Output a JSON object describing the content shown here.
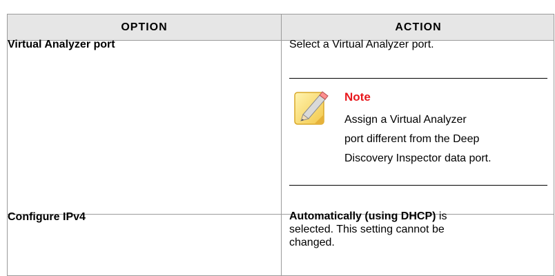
{
  "table": {
    "headers": {
      "option": "Option",
      "action": "Action"
    },
    "rows": [
      {
        "option": "Virtual Analyzer port",
        "action": "Select a Virtual Analyzer port.",
        "note": {
          "title": "Note",
          "lines": [
            "Assign a Virtual Analyzer",
            "port different from the Deep",
            "Discovery Inspector data port."
          ]
        }
      },
      {
        "option": "Configure IPv4",
        "action_bold": "Automatically (using DHCP)",
        "action_rest_lines": [
          " is",
          "selected. This setting cannot be",
          "changed."
        ]
      }
    ]
  },
  "colors": {
    "note_title": "#e8171c",
    "header_bg": "#e6e6e6",
    "border": "#9a9a9a"
  },
  "icons": {
    "note": "note-pencil-icon"
  }
}
